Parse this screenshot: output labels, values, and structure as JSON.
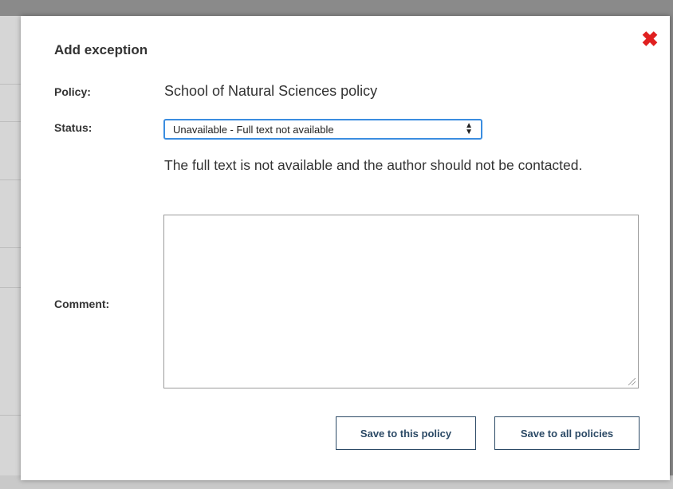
{
  "modal": {
    "title": "Add exception",
    "close_icon": "close-icon",
    "close_color": "#e02020"
  },
  "policy": {
    "label": "Policy:",
    "value": "School of Natural Sciences policy"
  },
  "status": {
    "label": "Status:",
    "selected": "Unavailable - Full text not available",
    "description": "The full text is not available and the author should not be contacted."
  },
  "comment": {
    "label": "Comment:",
    "value": ""
  },
  "buttons": {
    "save_policy": "Save to this policy",
    "save_all": "Save to all policies"
  },
  "colors": {
    "accent": "#3b8de0",
    "button_text": "#2c4a66"
  }
}
